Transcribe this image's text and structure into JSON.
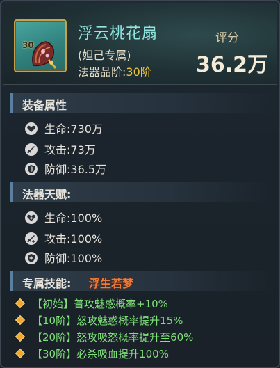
{
  "item": {
    "level": "30",
    "name": "浮云桃花扇",
    "subtitle": "(妲己专属)",
    "grade_label": "法器品阶:",
    "grade_value": "30阶"
  },
  "score": {
    "label": "评分",
    "value": "36.2万"
  },
  "equip_attrs": {
    "title": "装备属性",
    "rows": [
      {
        "icon": "heart-icon",
        "label": "生命:",
        "value": "730万"
      },
      {
        "icon": "sword-icon",
        "label": "攻击:",
        "value": "73万"
      },
      {
        "icon": "shield-icon",
        "label": "防御:",
        "value": "36.5万"
      }
    ]
  },
  "talent": {
    "title": "法器天赋:",
    "rows": [
      {
        "icon": "heart-plus-icon",
        "label": "生命:",
        "value": "100%"
      },
      {
        "icon": "sword-plus-icon",
        "label": "攻击:",
        "value": "100%"
      },
      {
        "icon": "shield-plus-icon",
        "label": "防御:",
        "value": "100%"
      }
    ]
  },
  "skill": {
    "title": "专属技能:",
    "name": "浮生若梦",
    "lines": [
      "【初始】普攻魅惑概率+10%",
      "【10阶】怒攻魅惑概率提升15%",
      "【20阶】怒攻吸怒概率提升至60%",
      "【30阶】必杀吸血提升100%"
    ]
  },
  "colors": {
    "name": "#8fe6e0",
    "grade": "#f0c23a",
    "skill_name": "#f07a3a",
    "skill_line": "#7fe07a"
  }
}
